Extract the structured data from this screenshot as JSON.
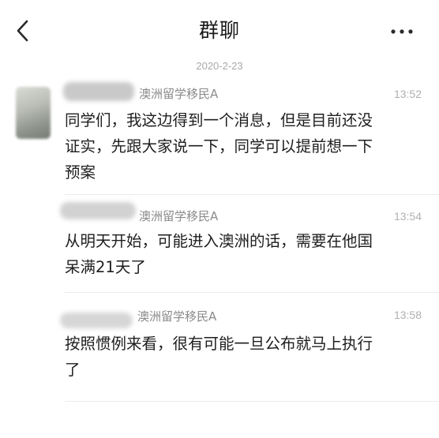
{
  "header": {
    "title": "群聊",
    "back_icon": "chevron-left-icon",
    "more_icon": "more-horizontal-icon"
  },
  "date_divider": "2020-2-23",
  "messages": [
    {
      "sender": "澳洲留学移民A",
      "time": "13:52",
      "lines": [
        "同学们，我这边得到一个消息，但是目前还没",
        "证实，先跟大家说一下，同学可以提前想一下",
        "预案"
      ]
    },
    {
      "sender": "澳洲留学移民A",
      "time": "13:54",
      "lines": [
        "从明天开始，可能进入澳洲的话，需要在他国",
        "呆满21天了"
      ]
    },
    {
      "sender": "澳洲留学移民A",
      "time": "13:58",
      "lines": [
        "按照惯例来看，很有可能一旦公布就马上执行",
        "了"
      ]
    }
  ],
  "colors": {
    "background": "#ffffff",
    "separator": "#ececec",
    "meta_text": "#a9a9a9"
  }
}
